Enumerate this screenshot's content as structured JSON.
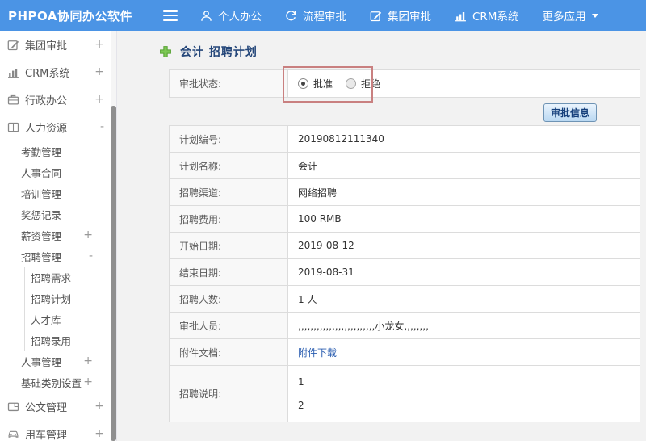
{
  "topbar": {
    "brand": "PHPOA协同办公软件",
    "nav": [
      {
        "icon": "person-icon",
        "label": "个人办公"
      },
      {
        "icon": "process-icon",
        "label": "流程审批"
      },
      {
        "icon": "edit-icon",
        "label": "集团审批"
      },
      {
        "icon": "chart-icon",
        "label": "CRM系统"
      },
      {
        "icon": "caret-down-icon",
        "label": "更多应用"
      }
    ]
  },
  "sidebar": {
    "items": [
      {
        "icon": "edit-square-icon",
        "label": "集团审批",
        "expand": "+"
      },
      {
        "icon": "bar-chart-icon",
        "label": "CRM系统",
        "expand": "+"
      },
      {
        "icon": "briefcase-icon",
        "label": "行政办公",
        "expand": "+"
      },
      {
        "icon": "book-icon",
        "label": "人力资源",
        "expand": "-"
      },
      {
        "label": "考勤管理"
      },
      {
        "label": "人事合同"
      },
      {
        "label": "培训管理"
      },
      {
        "label": "奖惩记录"
      },
      {
        "label": "薪资管理",
        "expand": "+"
      },
      {
        "label": "招聘管理",
        "expand": "-"
      },
      {
        "label": "招聘需求"
      },
      {
        "label": "招聘计划"
      },
      {
        "label": "人才库"
      },
      {
        "label": "招聘录用"
      },
      {
        "label": "人事管理",
        "expand": "+"
      },
      {
        "label": "基础类别设置",
        "expand": "+"
      },
      {
        "icon": "document-icon",
        "label": "公文管理",
        "expand": "+"
      },
      {
        "icon": "car-icon",
        "label": "用车管理",
        "expand": "+"
      }
    ]
  },
  "main": {
    "title": "会计 招聘计划",
    "status_row": {
      "label": "审批状态:",
      "options": [
        {
          "label": "批准",
          "selected": true
        },
        {
          "label": "拒绝",
          "selected": false
        }
      ]
    },
    "approve_button": "审批信息",
    "rows": [
      {
        "label": "计划编号:",
        "value": "20190812111340"
      },
      {
        "label": "计划名称:",
        "value": "会计"
      },
      {
        "label": "招聘渠道:",
        "value": "网络招聘"
      },
      {
        "label": "招聘费用:",
        "value": "100 RMB"
      },
      {
        "label": "开始日期:",
        "value": "2019-08-12"
      },
      {
        "label": "结束日期:",
        "value": "2019-08-31"
      },
      {
        "label": "招聘人数:",
        "value": "1 人"
      },
      {
        "label": "审批人员:",
        "value": ",,,,,,,,,,,,,,,,,,,,,,,,,小龙女,,,,,,,,"
      },
      {
        "label": "附件文档:",
        "value": "附件下载"
      },
      {
        "label": "招聘说明:",
        "lines": [
          "1",
          "2"
        ]
      }
    ]
  },
  "colors": {
    "topbar_blue": "#4b94e5",
    "link_blue": "#2a5db0",
    "annotation_red": "#c98080",
    "button_text_blue": "#16407c",
    "plus_green": "#7dc855"
  }
}
